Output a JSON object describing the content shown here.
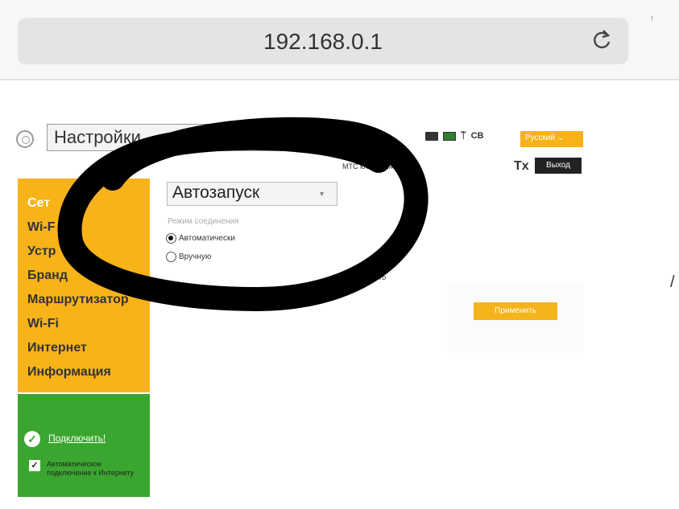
{
  "browser": {
    "url": "192.168.0.1",
    "corner_mark": "ᶠ",
    "reload_icon": "reload-icon"
  },
  "header": {
    "title": "Настройки",
    "language": "Русский ⌄",
    "connection_text": "МТС           ключения в сети",
    "tx_icon": "Tx",
    "logout_label": "Выход",
    "signal_text": "ᛠ",
    "network_text": "CB"
  },
  "sidebar": {
    "items": [
      {
        "label": "Сет",
        "active": true
      },
      {
        "label": "Wi-F",
        "active": false
      },
      {
        "label": "Устр",
        "active": false
      },
      {
        "label": "Бранд",
        "active": false
      },
      {
        "label": "Маршрутизатор",
        "active": false
      },
      {
        "label": "Wi-Fi",
        "active": false
      },
      {
        "label": "Интернет",
        "active": false
      },
      {
        "label": "Информация",
        "active": false
      }
    ],
    "connect": {
      "link_label": "Подключить!",
      "auto_label": "Автоматическое подключение к Интернету",
      "auto_checked": true
    }
  },
  "main": {
    "mode_select": "Автозапуск",
    "mode_section_label": "Режим соединения",
    "radios": [
      {
        "label": "Автоматически",
        "checked": true
      },
      {
        "label": "Вручную",
        "checked": false
      }
    ],
    "tail_text": "тего",
    "apply_label": "Применить"
  },
  "colors": {
    "accent_yellow": "#f8b319",
    "accent_green": "#3aa62f",
    "scribble": "#000000"
  }
}
